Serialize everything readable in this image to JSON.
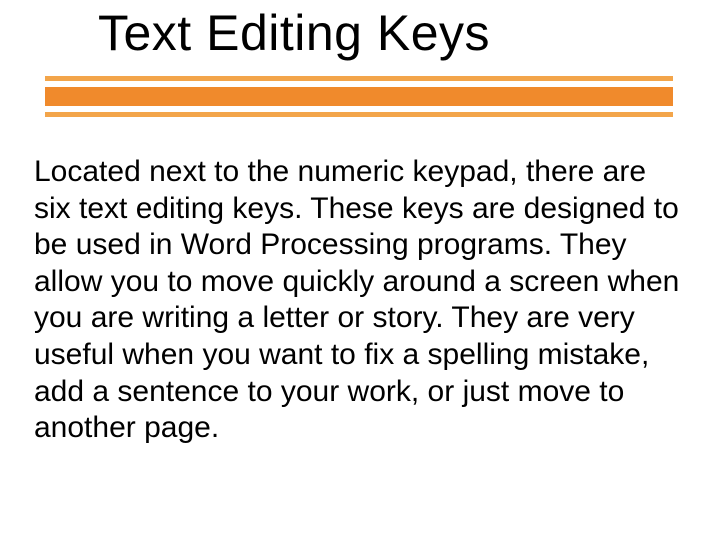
{
  "title": "Text Editing Keys",
  "body": "Located next to the numeric keypad, there are six text editing keys.  These keys are designed to be used in Word Processing programs.  They allow you to move quickly around a screen when you are writing a letter or story.  They are very useful when you want to fix a spelling mistake, add a sentence to your work, or just move to another page.",
  "colors": {
    "rule_outer": "#f3a54a",
    "rule_inner": "#f08a2c"
  }
}
